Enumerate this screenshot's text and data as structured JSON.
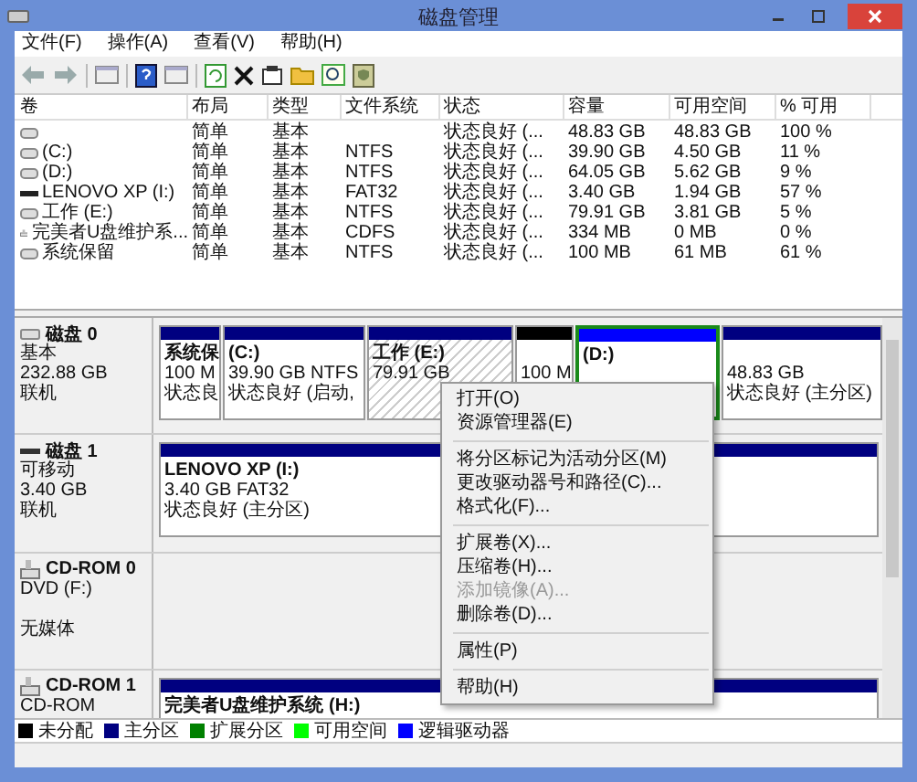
{
  "window": {
    "title": "磁盘管理"
  },
  "menu": [
    "文件(F)",
    "操作(A)",
    "查看(V)",
    "帮助(H)"
  ],
  "volumes": {
    "columns": [
      "卷",
      "布局",
      "类型",
      "文件系统",
      "状态",
      "容量",
      "可用空间",
      "% 可用"
    ],
    "rows": [
      {
        "kind": "disk",
        "cells": [
          "",
          "简单",
          "基本",
          "",
          "状态良好 (...",
          "48.83 GB",
          "48.83 GB",
          "100 %"
        ]
      },
      {
        "kind": "disk",
        "cells": [
          "(C:)",
          "简单",
          "基本",
          "NTFS",
          "状态良好 (...",
          "39.90 GB",
          "4.50 GB",
          "11 %"
        ]
      },
      {
        "kind": "disk",
        "cells": [
          "(D:)",
          "简单",
          "基本",
          "NTFS",
          "状态良好 (...",
          "64.05 GB",
          "5.62 GB",
          "9 %"
        ]
      },
      {
        "kind": "usb",
        "cells": [
          "LENOVO XP (I:)",
          "简单",
          "基本",
          "FAT32",
          "状态良好 (...",
          "3.40 GB",
          "1.94 GB",
          "57 %"
        ]
      },
      {
        "kind": "disk",
        "cells": [
          "工作 (E:)",
          "简单",
          "基本",
          "NTFS",
          "状态良好 (...",
          "79.91 GB",
          "3.81 GB",
          "5 %"
        ]
      },
      {
        "kind": "cd",
        "cells": [
          "完美者U盘维护系...",
          "简单",
          "基本",
          "CDFS",
          "状态良好 (...",
          "334 MB",
          "0 MB",
          "0 %"
        ]
      },
      {
        "kind": "disk",
        "cells": [
          "系统保留",
          "简单",
          "基本",
          "NTFS",
          "状态良好 (...",
          "100 MB",
          "61 MB",
          "61 %"
        ]
      }
    ]
  },
  "disks": [
    {
      "kind": "disk",
      "name": "磁盘 0",
      "type": "基本",
      "size": "232.88 GB",
      "state": "联机",
      "partitions": [
        {
          "kind": "primary",
          "selected": false,
          "name": "系统保",
          "lines": [
            "100 M",
            "状态良"
          ]
        },
        {
          "kind": "primary",
          "selected": false,
          "name": "(C:)",
          "lines": [
            "39.90 GB NTFS",
            "状态良好 (启动,"
          ]
        },
        {
          "kind": "primary",
          "selected": true,
          "name": "工作 (E:)",
          "lines": [
            "79.91 GB"
          ]
        },
        {
          "kind": "unallocated",
          "selected": false,
          "lines": [
            "100 M"
          ]
        },
        {
          "kind": "logical",
          "selected": false,
          "name": "(D:)"
        },
        {
          "kind": "primary",
          "selected": false,
          "lines": [
            "48.83 GB",
            "状态良好 (主分区)"
          ]
        }
      ]
    },
    {
      "kind": "usb",
      "name": "磁盘 1",
      "type": "可移动",
      "size": "3.40 GB",
      "state": "联机",
      "partitions": [
        {
          "kind": "primary",
          "selected": false,
          "name": "LENOVO XP  (I:)",
          "lines": [
            "3.40 GB FAT32",
            "状态良好 (主分区)"
          ]
        }
      ]
    },
    {
      "kind": "cd",
      "name": "CD-ROM 0",
      "type": "DVD (F:)",
      "state": "无媒体"
    },
    {
      "kind": "cd",
      "name": "CD-ROM 1",
      "type": "CD-ROM",
      "partitions": [
        {
          "kind": "primary",
          "selected": false,
          "name": "完美者U盘维护系统  (H:)"
        }
      ]
    }
  ],
  "legend": [
    {
      "label": "未分配",
      "color": "#000000"
    },
    {
      "label": "主分区",
      "color": "#000080"
    },
    {
      "label": "扩展分区",
      "color": "#008000"
    },
    {
      "label": "可用空间",
      "color": "#00ff00"
    },
    {
      "label": "逻辑驱动器",
      "color": "#0000ff"
    }
  ],
  "context_menu": [
    {
      "kind": "item",
      "label": "打开(O)",
      "disabled": false
    },
    {
      "kind": "item",
      "label": "资源管理器(E)",
      "disabled": false
    },
    {
      "kind": "separator"
    },
    {
      "kind": "item",
      "label": "将分区标记为活动分区(M)",
      "disabled": false
    },
    {
      "kind": "item",
      "label": "更改驱动器号和路径(C)...",
      "disabled": false
    },
    {
      "kind": "item",
      "label": "格式化(F)...",
      "disabled": false
    },
    {
      "kind": "separator"
    },
    {
      "kind": "item",
      "label": "扩展卷(X)...",
      "disabled": false
    },
    {
      "kind": "item",
      "label": "压缩卷(H)...",
      "disabled": false
    },
    {
      "kind": "item",
      "label": "添加镜像(A)...",
      "disabled": true
    },
    {
      "kind": "item",
      "label": "删除卷(D)...",
      "disabled": false
    },
    {
      "kind": "separator"
    },
    {
      "kind": "item",
      "label": "属性(P)",
      "disabled": false
    },
    {
      "kind": "separator"
    },
    {
      "kind": "item",
      "label": "帮助(H)",
      "disabled": false
    }
  ]
}
